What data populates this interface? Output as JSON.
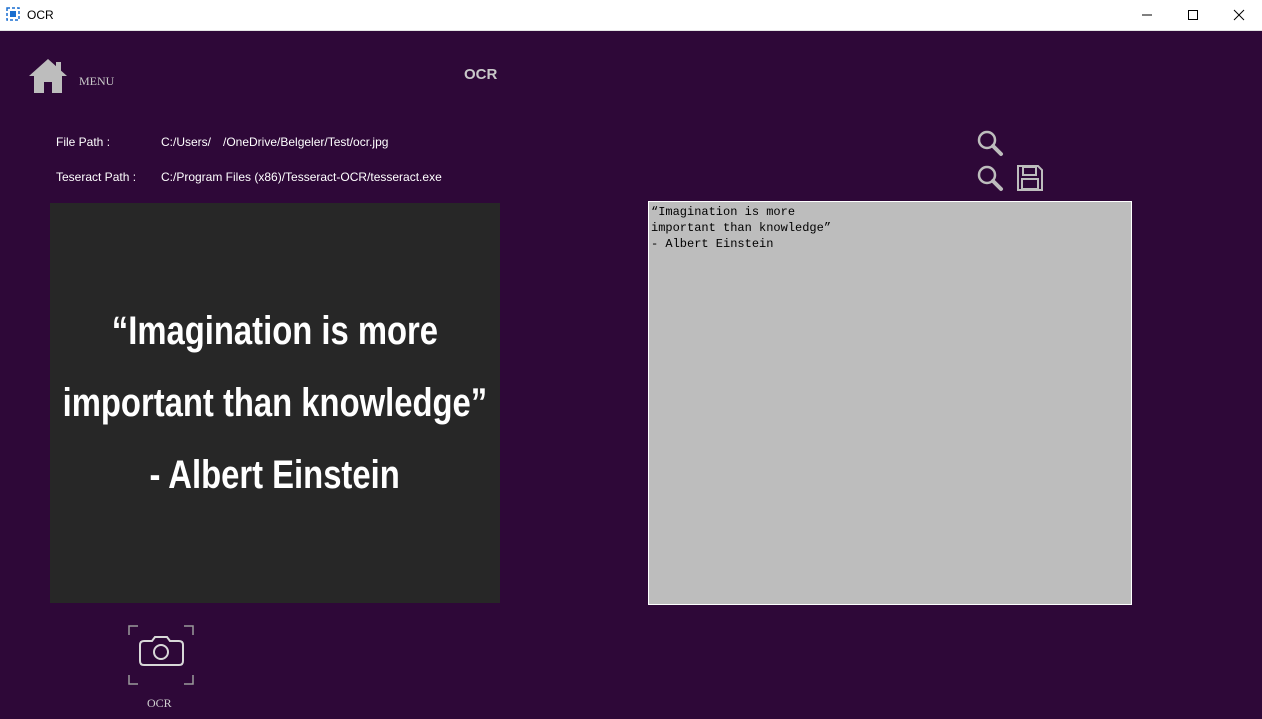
{
  "window": {
    "title": "OCR"
  },
  "header": {
    "menu_label": "MENU",
    "page_title": "OCR"
  },
  "paths": {
    "file_label": "File Path :",
    "file_value": "C:/Users/  /OneDrive/Belgeler/Test/ocr.jpg",
    "tesseract_label": "Teseract Path :",
    "tesseract_value": "C:/Program Files (x86)/Tesseract-OCR/tesseract.exe"
  },
  "image_preview": {
    "lines": [
      "“Imagination is more",
      "important than knowledge”",
      "- Albert Einstein"
    ]
  },
  "output": {
    "text": "“Imagination is more\nimportant than knowledge”\n- Albert Einstein"
  },
  "ocr_button": {
    "label": "OCR"
  },
  "icons": {
    "home": "home-icon",
    "search": "search-icon",
    "save": "save-icon",
    "camera": "camera-icon"
  },
  "colors": {
    "background": "#2e0838",
    "image_bg": "#272727",
    "output_bg": "#bdbdbd",
    "icon": "#bdbdbd"
  }
}
